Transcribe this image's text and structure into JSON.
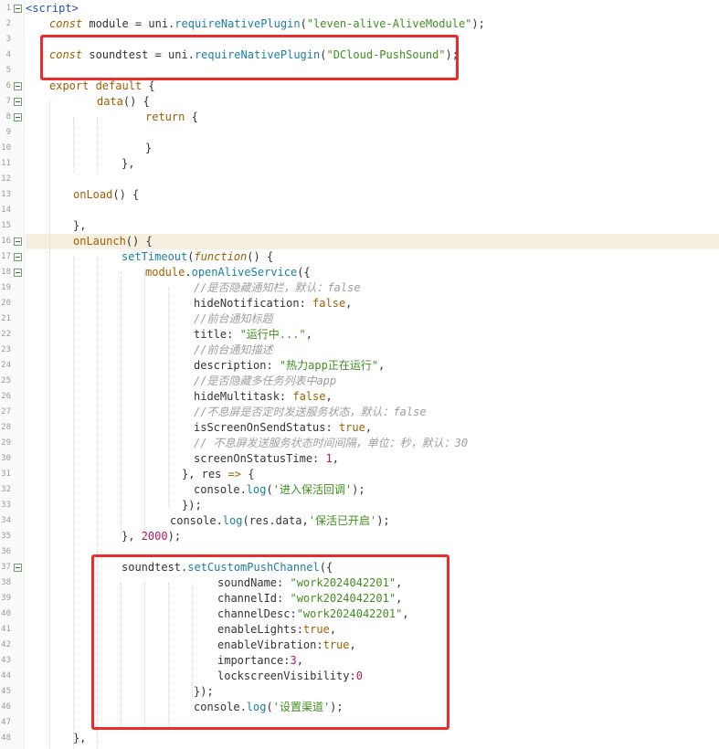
{
  "editor": {
    "lines": [
      {
        "n": "1",
        "indent": 0,
        "fold": true,
        "tokens": [
          [
            "tag",
            "<script>"
          ]
        ]
      },
      {
        "n": "2",
        "indent": 26,
        "tokens": [
          [
            "ital",
            "const"
          ],
          [
            "pl",
            " module = uni."
          ],
          [
            "fn",
            "requireNativePlugin"
          ],
          [
            "pl",
            "("
          ],
          [
            "str",
            "\"leven-alive-AliveModule\""
          ],
          [
            "pl",
            ");"
          ]
        ]
      },
      {
        "n": "3",
        "indent": 0,
        "tokens": []
      },
      {
        "n": "4",
        "indent": 26,
        "tokens": [
          [
            "ital",
            "const"
          ],
          [
            "pl",
            " soundtest = uni."
          ],
          [
            "fn",
            "requireNativePlugin"
          ],
          [
            "pl",
            "("
          ],
          [
            "str",
            "\"DCloud-PushSound\""
          ],
          [
            "pl",
            ");"
          ]
        ]
      },
      {
        "n": "5",
        "indent": 0,
        "tokens": []
      },
      {
        "n": "6",
        "indent": 26,
        "fold": true,
        "tokens": [
          [
            "kw",
            "export default"
          ],
          [
            "pl",
            " {"
          ]
        ]
      },
      {
        "n": "7",
        "indent": 78,
        "fold": true,
        "tokens": [
          [
            "kw",
            "data"
          ],
          [
            "pl",
            "() {"
          ]
        ]
      },
      {
        "n": "8",
        "indent": 131,
        "fold": true,
        "tokens": [
          [
            "kw",
            "return"
          ],
          [
            "pl",
            " {"
          ]
        ]
      },
      {
        "n": "9",
        "indent": 0,
        "tokens": []
      },
      {
        "n": "10",
        "indent": 131,
        "tokens": [
          [
            "pl",
            "}"
          ]
        ]
      },
      {
        "n": "11",
        "indent": 105,
        "tokens": [
          [
            "pl",
            "},"
          ]
        ]
      },
      {
        "n": "12",
        "indent": 0,
        "tokens": []
      },
      {
        "n": "13",
        "indent": 52,
        "tokens": [
          [
            "kw",
            "onLoad"
          ],
          [
            "pl",
            "() {"
          ]
        ]
      },
      {
        "n": "14",
        "indent": 0,
        "tokens": []
      },
      {
        "n": "15",
        "indent": 52,
        "tokens": [
          [
            "pl",
            "},"
          ]
        ]
      },
      {
        "n": "16",
        "indent": 52,
        "fold": true,
        "hl": true,
        "tokens": [
          [
            "kw",
            "onLaunch"
          ],
          [
            "pl",
            "() {"
          ]
        ]
      },
      {
        "n": "17",
        "indent": 105,
        "fold": true,
        "tokens": [
          [
            "fn",
            "setTimeout"
          ],
          [
            "pl",
            "("
          ],
          [
            "ital",
            "function"
          ],
          [
            "pl",
            "() {"
          ]
        ]
      },
      {
        "n": "18",
        "indent": 131,
        "fold": true,
        "tokens": [
          [
            "kw",
            "module"
          ],
          [
            "pl",
            "."
          ],
          [
            "fn",
            "openAliveService"
          ],
          [
            "pl",
            "({"
          ]
        ]
      },
      {
        "n": "19",
        "indent": 184,
        "tokens": [
          [
            "cm",
            "//是否隐藏通知栏，默认：false"
          ]
        ]
      },
      {
        "n": "20",
        "indent": 184,
        "tokens": [
          [
            "pl",
            "hideNotification: "
          ],
          [
            "kw",
            "false"
          ],
          [
            "pl",
            ","
          ]
        ]
      },
      {
        "n": "21",
        "indent": 184,
        "tokens": [
          [
            "cm",
            "//前台通知标题"
          ]
        ]
      },
      {
        "n": "22",
        "indent": 184,
        "tokens": [
          [
            "pl",
            "title: "
          ],
          [
            "str",
            "\"运行中...\""
          ],
          [
            "pl",
            ","
          ]
        ]
      },
      {
        "n": "23",
        "indent": 184,
        "tokens": [
          [
            "cm",
            "//前台通知描述"
          ]
        ]
      },
      {
        "n": "24",
        "indent": 184,
        "tokens": [
          [
            "pl",
            "description: "
          ],
          [
            "str",
            "\"热力app正在运行\""
          ],
          [
            "pl",
            ","
          ]
        ]
      },
      {
        "n": "25",
        "indent": 184,
        "tokens": [
          [
            "cm",
            "//是否隐藏多任务列表中app"
          ]
        ]
      },
      {
        "n": "26",
        "indent": 184,
        "tokens": [
          [
            "pl",
            "hideMultitask: "
          ],
          [
            "kw",
            "false"
          ],
          [
            "pl",
            ","
          ]
        ]
      },
      {
        "n": "27",
        "indent": 184,
        "tokens": [
          [
            "cm",
            "//不息屏是否定时发送服务状态，默认：false"
          ]
        ]
      },
      {
        "n": "28",
        "indent": 184,
        "tokens": [
          [
            "pl",
            "isScreenOnSendStatus: "
          ],
          [
            "kw",
            "true"
          ],
          [
            "pl",
            ","
          ]
        ]
      },
      {
        "n": "29",
        "indent": 184,
        "tokens": [
          [
            "cm",
            "// 不息屏发送服务状态时间间隔，单位：秒，默认：30"
          ]
        ]
      },
      {
        "n": "30",
        "indent": 184,
        "tokens": [
          [
            "pl",
            "screenOnStatusTime: "
          ],
          [
            "num",
            "1"
          ],
          [
            "pl",
            ","
          ]
        ]
      },
      {
        "n": "31",
        "indent": 171,
        "tokens": [
          [
            "pl",
            "}, res "
          ],
          [
            "kw",
            "=>"
          ],
          [
            "pl",
            " {"
          ]
        ]
      },
      {
        "n": "32",
        "indent": 184,
        "tokens": [
          [
            "pl",
            "console."
          ],
          [
            "fn",
            "log"
          ],
          [
            "pl",
            "("
          ],
          [
            "str",
            "'进入保活回调'"
          ],
          [
            "pl",
            ");"
          ]
        ]
      },
      {
        "n": "33",
        "indent": 171,
        "tokens": [
          [
            "pl",
            "});"
          ]
        ]
      },
      {
        "n": "34",
        "indent": 158,
        "tokens": [
          [
            "pl",
            "console."
          ],
          [
            "fn",
            "log"
          ],
          [
            "pl",
            "(res.data,"
          ],
          [
            "str",
            "'保活已开启'"
          ],
          [
            "pl",
            ");"
          ]
        ]
      },
      {
        "n": "35",
        "indent": 105,
        "tokens": [
          [
            "pl",
            "}, "
          ],
          [
            "num",
            "2000"
          ],
          [
            "pl",
            ");"
          ]
        ]
      },
      {
        "n": "36",
        "indent": 0,
        "tokens": []
      },
      {
        "n": "37",
        "indent": 105,
        "fold": true,
        "tokens": [
          [
            "pl",
            "soundtest."
          ],
          [
            "fn",
            "setCustomPushChannel"
          ],
          [
            "pl",
            "({"
          ]
        ]
      },
      {
        "n": "38",
        "indent": 210,
        "tokens": [
          [
            "pl",
            "soundName: "
          ],
          [
            "str",
            "\"work2024042201\""
          ],
          [
            "pl",
            ","
          ]
        ]
      },
      {
        "n": "39",
        "indent": 210,
        "tokens": [
          [
            "pl",
            "channelId: "
          ],
          [
            "str",
            "\"work2024042201\""
          ],
          [
            "pl",
            ","
          ]
        ]
      },
      {
        "n": "40",
        "indent": 210,
        "tokens": [
          [
            "pl",
            "channelDesc:"
          ],
          [
            "str",
            "\"work2024042201\""
          ],
          [
            "pl",
            ","
          ]
        ]
      },
      {
        "n": "41",
        "indent": 210,
        "tokens": [
          [
            "pl",
            "enableLights:"
          ],
          [
            "kw",
            "true"
          ],
          [
            "pl",
            ","
          ]
        ]
      },
      {
        "n": "42",
        "indent": 210,
        "tokens": [
          [
            "pl",
            "enableVibration:"
          ],
          [
            "kw",
            "true"
          ],
          [
            "pl",
            ","
          ]
        ]
      },
      {
        "n": "43",
        "indent": 210,
        "tokens": [
          [
            "pl",
            "importance:"
          ],
          [
            "num",
            "3"
          ],
          [
            "pl",
            ","
          ]
        ]
      },
      {
        "n": "44",
        "indent": 210,
        "tokens": [
          [
            "pl",
            "lockscreenVisibility:"
          ],
          [
            "num",
            "0"
          ]
        ]
      },
      {
        "n": "45",
        "indent": 184,
        "tokens": [
          [
            "pl",
            "});"
          ]
        ]
      },
      {
        "n": "46",
        "indent": 184,
        "tokens": [
          [
            "pl",
            "console."
          ],
          [
            "fn",
            "log"
          ],
          [
            "pl",
            "("
          ],
          [
            "str",
            "'设置渠道'"
          ],
          [
            "pl",
            ");"
          ]
        ]
      },
      {
        "n": "47",
        "indent": 0,
        "tokens": []
      },
      {
        "n": "48",
        "indent": 52,
        "tokens": [
          [
            "pl",
            "},"
          ]
        ]
      }
    ]
  },
  "colors": {
    "highlight_box": "#ee2b2b",
    "current_line": "#f5efe0"
  }
}
